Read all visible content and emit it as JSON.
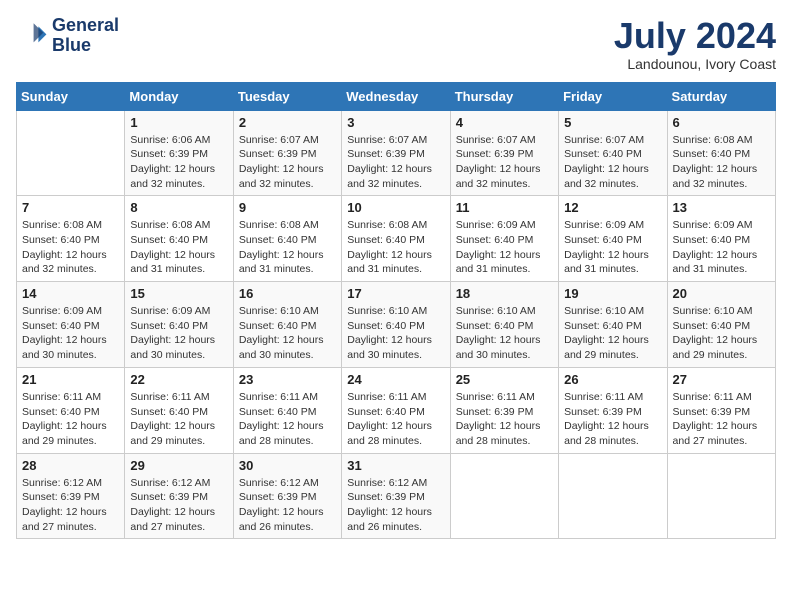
{
  "header": {
    "logo_line1": "General",
    "logo_line2": "Blue",
    "month_year": "July 2024",
    "location": "Landounou, Ivory Coast"
  },
  "weekdays": [
    "Sunday",
    "Monday",
    "Tuesday",
    "Wednesday",
    "Thursday",
    "Friday",
    "Saturday"
  ],
  "weeks": [
    [
      {
        "day": "",
        "info": ""
      },
      {
        "day": "1",
        "info": "Sunrise: 6:06 AM\nSunset: 6:39 PM\nDaylight: 12 hours\nand 32 minutes."
      },
      {
        "day": "2",
        "info": "Sunrise: 6:07 AM\nSunset: 6:39 PM\nDaylight: 12 hours\nand 32 minutes."
      },
      {
        "day": "3",
        "info": "Sunrise: 6:07 AM\nSunset: 6:39 PM\nDaylight: 12 hours\nand 32 minutes."
      },
      {
        "day": "4",
        "info": "Sunrise: 6:07 AM\nSunset: 6:39 PM\nDaylight: 12 hours\nand 32 minutes."
      },
      {
        "day": "5",
        "info": "Sunrise: 6:07 AM\nSunset: 6:40 PM\nDaylight: 12 hours\nand 32 minutes."
      },
      {
        "day": "6",
        "info": "Sunrise: 6:08 AM\nSunset: 6:40 PM\nDaylight: 12 hours\nand 32 minutes."
      }
    ],
    [
      {
        "day": "7",
        "info": "Sunrise: 6:08 AM\nSunset: 6:40 PM\nDaylight: 12 hours\nand 32 minutes."
      },
      {
        "day": "8",
        "info": "Sunrise: 6:08 AM\nSunset: 6:40 PM\nDaylight: 12 hours\nand 31 minutes."
      },
      {
        "day": "9",
        "info": "Sunrise: 6:08 AM\nSunset: 6:40 PM\nDaylight: 12 hours\nand 31 minutes."
      },
      {
        "day": "10",
        "info": "Sunrise: 6:08 AM\nSunset: 6:40 PM\nDaylight: 12 hours\nand 31 minutes."
      },
      {
        "day": "11",
        "info": "Sunrise: 6:09 AM\nSunset: 6:40 PM\nDaylight: 12 hours\nand 31 minutes."
      },
      {
        "day": "12",
        "info": "Sunrise: 6:09 AM\nSunset: 6:40 PM\nDaylight: 12 hours\nand 31 minutes."
      },
      {
        "day": "13",
        "info": "Sunrise: 6:09 AM\nSunset: 6:40 PM\nDaylight: 12 hours\nand 31 minutes."
      }
    ],
    [
      {
        "day": "14",
        "info": "Sunrise: 6:09 AM\nSunset: 6:40 PM\nDaylight: 12 hours\nand 30 minutes."
      },
      {
        "day": "15",
        "info": "Sunrise: 6:09 AM\nSunset: 6:40 PM\nDaylight: 12 hours\nand 30 minutes."
      },
      {
        "day": "16",
        "info": "Sunrise: 6:10 AM\nSunset: 6:40 PM\nDaylight: 12 hours\nand 30 minutes."
      },
      {
        "day": "17",
        "info": "Sunrise: 6:10 AM\nSunset: 6:40 PM\nDaylight: 12 hours\nand 30 minutes."
      },
      {
        "day": "18",
        "info": "Sunrise: 6:10 AM\nSunset: 6:40 PM\nDaylight: 12 hours\nand 30 minutes."
      },
      {
        "day": "19",
        "info": "Sunrise: 6:10 AM\nSunset: 6:40 PM\nDaylight: 12 hours\nand 29 minutes."
      },
      {
        "day": "20",
        "info": "Sunrise: 6:10 AM\nSunset: 6:40 PM\nDaylight: 12 hours\nand 29 minutes."
      }
    ],
    [
      {
        "day": "21",
        "info": "Sunrise: 6:11 AM\nSunset: 6:40 PM\nDaylight: 12 hours\nand 29 minutes."
      },
      {
        "day": "22",
        "info": "Sunrise: 6:11 AM\nSunset: 6:40 PM\nDaylight: 12 hours\nand 29 minutes."
      },
      {
        "day": "23",
        "info": "Sunrise: 6:11 AM\nSunset: 6:40 PM\nDaylight: 12 hours\nand 28 minutes."
      },
      {
        "day": "24",
        "info": "Sunrise: 6:11 AM\nSunset: 6:40 PM\nDaylight: 12 hours\nand 28 minutes."
      },
      {
        "day": "25",
        "info": "Sunrise: 6:11 AM\nSunset: 6:39 PM\nDaylight: 12 hours\nand 28 minutes."
      },
      {
        "day": "26",
        "info": "Sunrise: 6:11 AM\nSunset: 6:39 PM\nDaylight: 12 hours\nand 28 minutes."
      },
      {
        "day": "27",
        "info": "Sunrise: 6:11 AM\nSunset: 6:39 PM\nDaylight: 12 hours\nand 27 minutes."
      }
    ],
    [
      {
        "day": "28",
        "info": "Sunrise: 6:12 AM\nSunset: 6:39 PM\nDaylight: 12 hours\nand 27 minutes."
      },
      {
        "day": "29",
        "info": "Sunrise: 6:12 AM\nSunset: 6:39 PM\nDaylight: 12 hours\nand 27 minutes."
      },
      {
        "day": "30",
        "info": "Sunrise: 6:12 AM\nSunset: 6:39 PM\nDaylight: 12 hours\nand 26 minutes."
      },
      {
        "day": "31",
        "info": "Sunrise: 6:12 AM\nSunset: 6:39 PM\nDaylight: 12 hours\nand 26 minutes."
      },
      {
        "day": "",
        "info": ""
      },
      {
        "day": "",
        "info": ""
      },
      {
        "day": "",
        "info": ""
      }
    ]
  ]
}
